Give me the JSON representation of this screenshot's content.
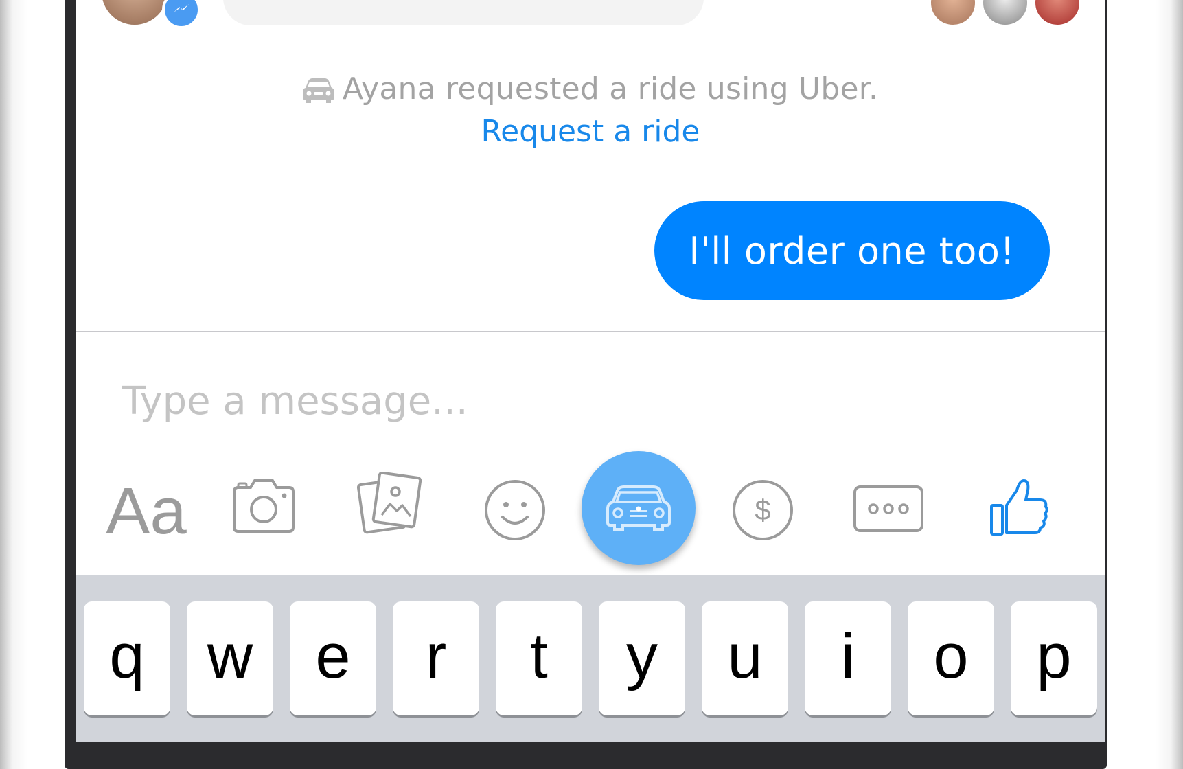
{
  "conversation": {
    "ride_notice": "Ayana requested a ride using Uber.",
    "request_link": "Request a ride",
    "sent_message": "I'll order one too!"
  },
  "composer": {
    "placeholder": "Type a message..."
  },
  "toolbar": {
    "text_format_label": "Aa",
    "icons": [
      "text-format-icon",
      "camera-icon",
      "photo-gallery-icon",
      "emoji-icon",
      "car-icon",
      "dollar-icon",
      "more-icon",
      "thumbs-up-icon"
    ]
  },
  "keyboard": {
    "row1": [
      "q",
      "w",
      "e",
      "r",
      "t",
      "y",
      "u",
      "i",
      "o",
      "p"
    ]
  },
  "colors": {
    "accent": "#0084ff",
    "link": "#1888ea",
    "ride_button": "#5eb0f7",
    "icon_gray": "#9b9b9b",
    "keyboard_bg": "#d1d4da"
  }
}
